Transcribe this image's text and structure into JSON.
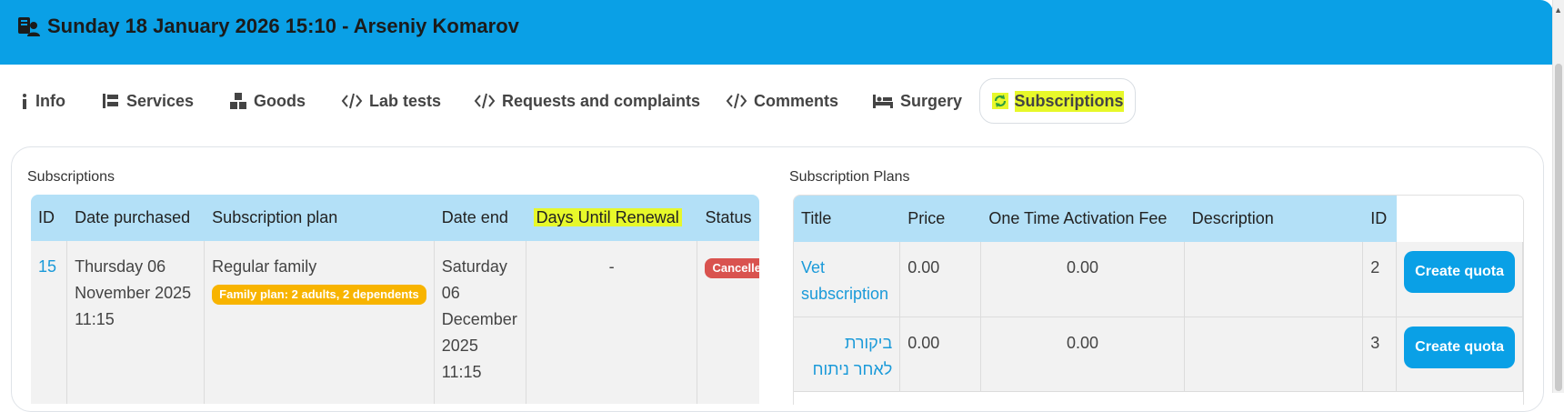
{
  "header": {
    "title": "Sunday 18 January 2026 15:10 - Arseniy Komarov",
    "icon": "patient-card-icon",
    "background_color": "#0aa0e6"
  },
  "tabs": [
    {
      "label": "Info",
      "icon": "info-icon"
    },
    {
      "label": "Services",
      "icon": "services-icon"
    },
    {
      "label": "Goods",
      "icon": "boxes-icon"
    },
    {
      "label": "Lab tests",
      "icon": "code-icon"
    },
    {
      "label": "Requests and complaints",
      "icon": "code-icon"
    },
    {
      "label": "Comments",
      "icon": "code-icon"
    },
    {
      "label": "Surgery",
      "icon": "bed-icon"
    },
    {
      "label": "Subscriptions",
      "icon": "recycle-icon",
      "active": true
    }
  ],
  "subscriptions": {
    "title": "Subscriptions",
    "columns": [
      "ID",
      "Date purchased",
      "Subscription plan",
      "Date end",
      "Days Until Renewal",
      "Status"
    ],
    "rows": [
      {
        "id": "15",
        "date_purchased": [
          "Thursday 06",
          "November 2025",
          "11:15"
        ],
        "plan": "Regular family",
        "plan_badge": "Family plan: 2 adults, 2 dependents",
        "date_end": [
          "Saturday",
          "06",
          "December",
          "2025",
          "11:15"
        ],
        "days_until_renewal": "-",
        "status": "Cancelle"
      }
    ]
  },
  "plans": {
    "title": "Subscription Plans",
    "columns": [
      "Title",
      "Price",
      "One Time Activation Fee",
      "Description",
      "ID",
      ""
    ],
    "rows": [
      {
        "title": [
          "Vet",
          "subscription"
        ],
        "price": "0.00",
        "fee": "0.00",
        "description": "",
        "id": "2",
        "action": "Create quota"
      },
      {
        "title": [
          "ביקורת",
          "לאחר ניתוח"
        ],
        "price": "0.00",
        "fee": "0.00",
        "description": "",
        "id": "3",
        "action": "Create quota"
      }
    ]
  },
  "colors": {
    "accent": "#0aa0e6",
    "table_header": "#b3e0f7",
    "highlight": "#e7f82a",
    "badge_yellow": "#f8b400",
    "badge_red": "#d9534f",
    "link": "#1a9ad9"
  }
}
